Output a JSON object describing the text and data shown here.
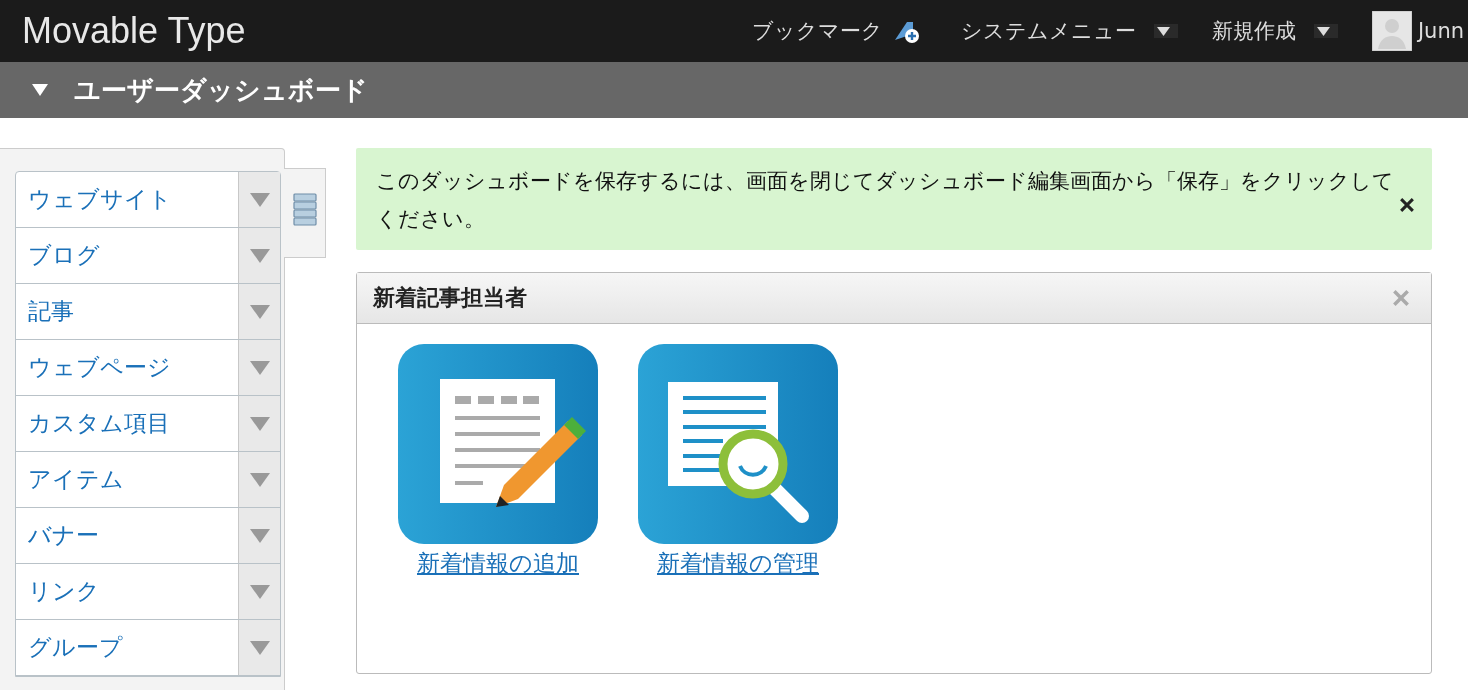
{
  "topbar": {
    "logo": "Movable Type",
    "bookmark": "ブックマーク",
    "system_menu": "システムメニュー",
    "new": "新規作成",
    "user": "Junn"
  },
  "header": {
    "title": "ユーザーダッシュボード",
    "expanded": true
  },
  "sidebar": {
    "items": [
      {
        "label": "ウェブサイト"
      },
      {
        "label": "ブログ"
      },
      {
        "label": "記事"
      },
      {
        "label": "ウェブページ"
      },
      {
        "label": "カスタム項目"
      },
      {
        "label": "アイテム"
      },
      {
        "label": "バナー"
      },
      {
        "label": "リンク"
      },
      {
        "label": "グループ"
      }
    ]
  },
  "notice": {
    "text": "このダッシュボードを保存するには、画面を閉じてダッシュボード編集画面から「保存」をクリックしてください。"
  },
  "widget": {
    "title": "新着記事担当者",
    "links": [
      {
        "kind": "add",
        "label": "新着情報の追加"
      },
      {
        "kind": "manage",
        "label": "新着情報の管理"
      }
    ]
  }
}
